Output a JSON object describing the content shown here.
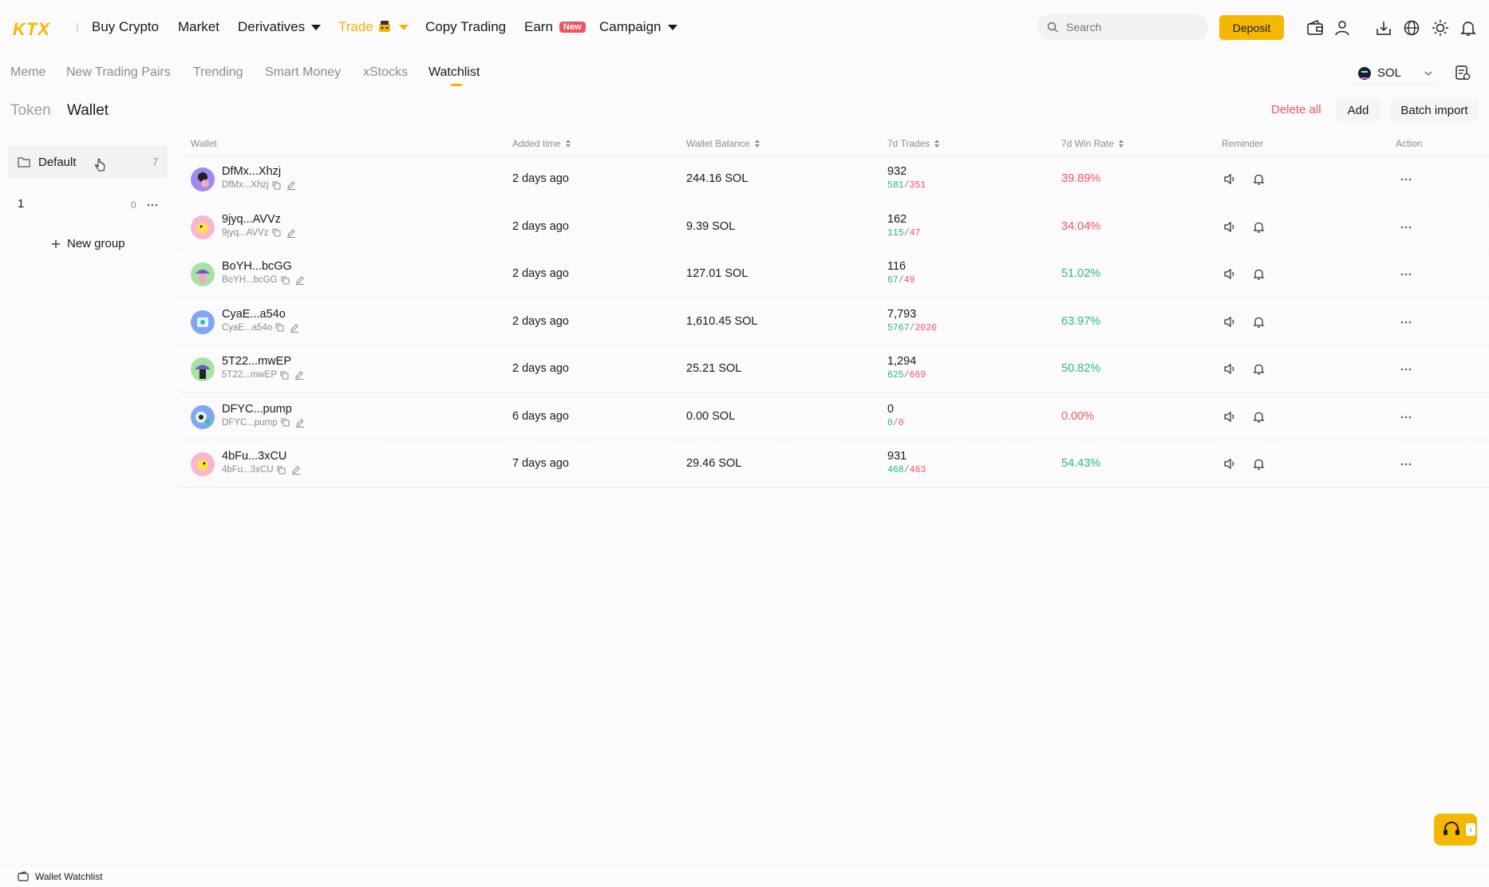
{
  "nav": {
    "logo": "KTX",
    "items": [
      {
        "label": "Buy Crypto"
      },
      {
        "label": "Market"
      },
      {
        "label": "Derivatives"
      },
      {
        "label": "Trade"
      },
      {
        "label": "Copy Trading"
      },
      {
        "label": "Earn",
        "badge": "New"
      },
      {
        "label": "Campaign"
      }
    ],
    "search_placeholder": "Search",
    "deposit_label": "Deposit"
  },
  "subtabs": [
    "Meme",
    "New Trading Pairs",
    "Trending",
    "Smart Money",
    "xStocks",
    "Watchlist"
  ],
  "active_subtab": "Watchlist",
  "chain": "SOL",
  "view_tabs": {
    "token": "Token",
    "wallet": "Wallet",
    "active": "Wallet"
  },
  "actions": {
    "delete_all": "Delete all",
    "add": "Add",
    "batch_import": "Batch import"
  },
  "groups": [
    {
      "name": "Default",
      "count": "7"
    },
    {
      "name": "1",
      "count": "0"
    }
  ],
  "new_group_label": "New group",
  "table": {
    "headers": {
      "wallet": "Wallet",
      "added_time": "Added time",
      "balance": "Wallet Balance",
      "trades": "7d Trades",
      "win_rate": "7d Win Rate",
      "reminder": "Reminder",
      "action": "Action"
    },
    "rows": [
      {
        "name": "DfMx...Xhzj",
        "addr": "DfMx...Xhzj",
        "added": "2 days ago",
        "balance": "244.16 SOL",
        "trades": "932",
        "wins": "581",
        "losses": "351",
        "win_rate": "39.89%",
        "rate_color": "red"
      },
      {
        "name": "9jyq...AVVz",
        "addr": "9jyq...AVVz",
        "added": "2 days ago",
        "balance": "9.39 SOL",
        "trades": "162",
        "wins": "115",
        "losses": "47",
        "win_rate": "34.04%",
        "rate_color": "red"
      },
      {
        "name": "BoYH...bcGG",
        "addr": "BoYH...bcGG",
        "added": "2 days ago",
        "balance": "127.01 SOL",
        "trades": "116",
        "wins": "67",
        "losses": "49",
        "win_rate": "51.02%",
        "rate_color": "green"
      },
      {
        "name": "CyaE...a54o",
        "addr": "CyaE...a54o",
        "added": "2 days ago",
        "balance": "1,610.45 SOL",
        "trades": "7,793",
        "wins": "5767",
        "losses": "2026",
        "win_rate": "63.97%",
        "rate_color": "green"
      },
      {
        "name": "5T22...mwEP",
        "addr": "5T22...mwEP",
        "added": "2 days ago",
        "balance": "25.21 SOL",
        "trades": "1,294",
        "wins": "625",
        "losses": "669",
        "win_rate": "50.82%",
        "rate_color": "green"
      },
      {
        "name": "DFYC...pump",
        "addr": "DFYC...pump",
        "added": "6 days ago",
        "balance": "0.00 SOL",
        "trades": "0",
        "wins": "0",
        "losses": "0",
        "win_rate": "0.00%",
        "rate_color": "red"
      },
      {
        "name": "4bFu...3xCU",
        "addr": "4bFu...3xCU",
        "added": "7 days ago",
        "balance": "29.46 SOL",
        "trades": "931",
        "wins": "468",
        "losses": "463",
        "win_rate": "54.43%",
        "rate_color": "green"
      }
    ]
  },
  "footer": {
    "label": "Wallet Watchlist"
  },
  "colors": {
    "accent": "#f5b700",
    "up": "#2eb87a",
    "down": "#f0545e"
  }
}
